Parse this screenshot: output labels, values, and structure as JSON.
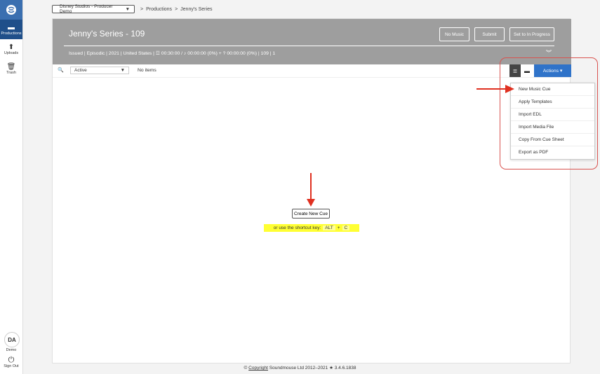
{
  "sidebar": {
    "items": [
      {
        "label": "Productions",
        "icon": "clapperboard-icon",
        "active": true
      },
      {
        "label": "Uploads",
        "icon": "upload-arrow-icon",
        "active": false
      },
      {
        "label": "Trash",
        "icon": "trash-icon",
        "active": false
      }
    ],
    "user_initials": "DA",
    "user_label": "Demo",
    "signout_label": "Sign Out"
  },
  "topbar": {
    "org_select": "Disney Studios - Producer Demo",
    "breadcrumb": [
      ">",
      "Productions",
      ">",
      "Jenny's Series"
    ]
  },
  "header": {
    "title": "Jenny's Series - 109",
    "buttons": {
      "no_music": "No Music",
      "submit": "Submit",
      "in_progress": "Set to In Progress"
    },
    "meta": "Issued | Episodic | 2021 | United States | ☲ 00:30:00 / ♪ 00:00:00 (0%) + ? 00:00:00 (0%) | 109 | 1"
  },
  "toolbar": {
    "status": "Active",
    "count": "No items",
    "actions_label": "Actions ▾"
  },
  "actions_menu": [
    "New Music Cue",
    "Apply Templates",
    "Import EDL",
    "Import Media File",
    "Copy From Cue Sheet",
    "Export as PDF"
  ],
  "empty_state": {
    "create_label": "Create New Cue",
    "shortcut_text": "or use the shortcut key:",
    "key1": "ALT",
    "plus": "+",
    "key2": "C"
  },
  "footer": {
    "copyright_symbol": "©",
    "copyright_link": "Copyright",
    "text": "Soundmouse Ltd 2012–2021 ★ 3.4.6.1838"
  },
  "colors": {
    "header_bg": "#9e9e9e",
    "actions_blue": "#2f73c9",
    "nav_active": "#1f4f8a",
    "annotation_red": "#d9534f",
    "highlight_yellow": "#ffff33"
  }
}
